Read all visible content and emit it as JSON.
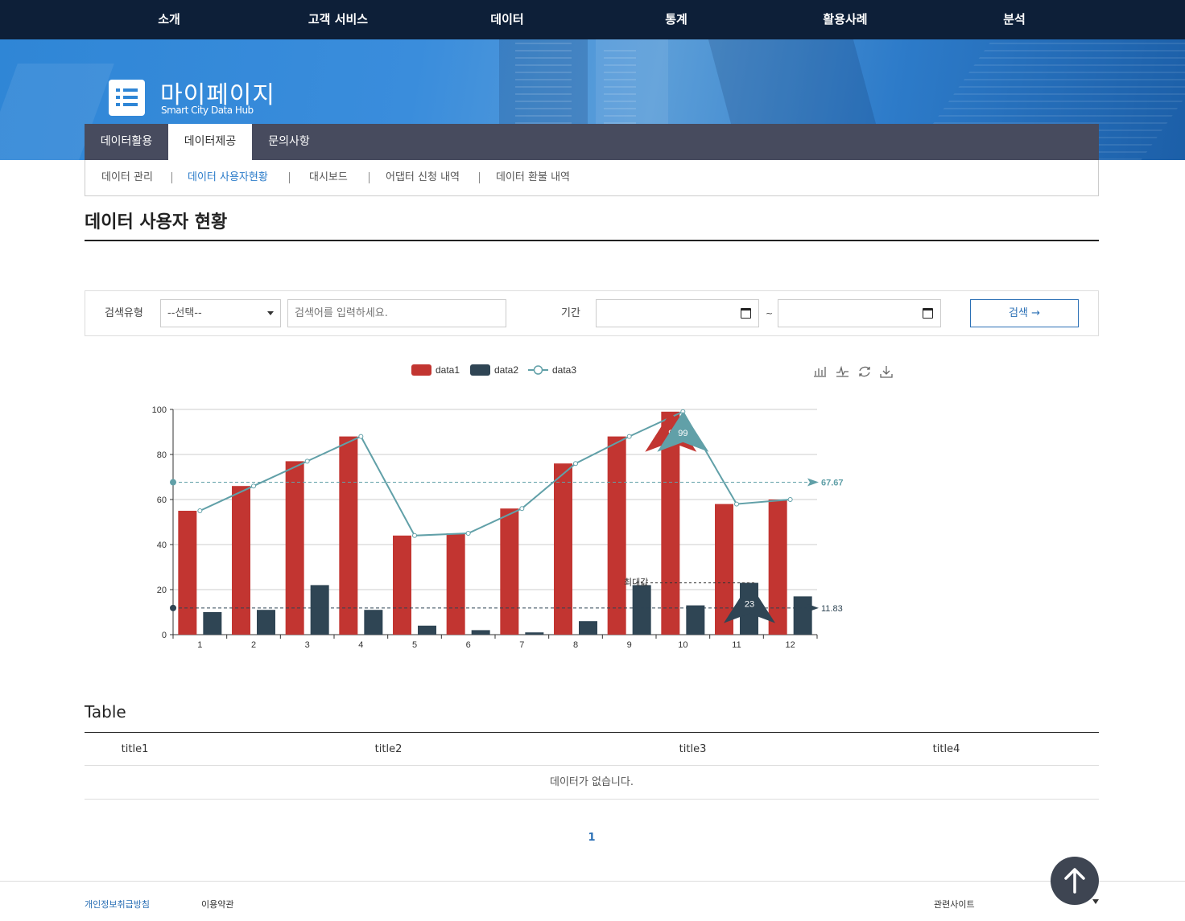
{
  "topnav": [
    "소개",
    "고객 서비스",
    "데이터",
    "통계",
    "활용사례",
    "분석"
  ],
  "banner": {
    "title": "마이페이지",
    "subtitle": "Smart City Data Hub",
    "icon": "list-icon"
  },
  "tabs": [
    {
      "label": "데이터활용",
      "active": false
    },
    {
      "label": "데이터제공",
      "active": true
    },
    {
      "label": "문의사항",
      "active": false
    }
  ],
  "subnav": [
    {
      "label": "데이터 관리",
      "active": false
    },
    {
      "label": "데이터 사용자현황",
      "active": true
    },
    {
      "label": "대시보드",
      "active": false
    },
    {
      "label": "어댑터 신청 내역",
      "active": false
    },
    {
      "label": "데이터 환불 내역",
      "active": false
    }
  ],
  "page_title": "데이터 사용자 현황",
  "search": {
    "type_label": "검색유형",
    "type_value": "--선택--",
    "keyword_placeholder": "검색어를 입력하세요.",
    "period_label": "기간",
    "tilde": "~",
    "button_label": "검색 →"
  },
  "chart_data": {
    "type": "bar",
    "categories": [
      "1",
      "2",
      "3",
      "4",
      "5",
      "6",
      "7",
      "8",
      "9",
      "10",
      "11",
      "12"
    ],
    "series": [
      {
        "name": "data1",
        "type": "bar",
        "color": "#c23531",
        "values": [
          55,
          66,
          77,
          88,
          44,
          45,
          56,
          76,
          88,
          99,
          58,
          60
        ]
      },
      {
        "name": "data2",
        "type": "bar",
        "color": "#2f4554",
        "values": [
          10,
          11,
          22,
          11,
          4,
          2,
          1,
          6,
          22,
          13,
          23,
          17
        ]
      },
      {
        "name": "data3",
        "type": "line",
        "color": "#61a0a8",
        "values": [
          55,
          66,
          77,
          88,
          44,
          45,
          56,
          76,
          88,
          99,
          58,
          60
        ]
      }
    ],
    "ylim": [
      0,
      100
    ],
    "yticks": [
      0,
      20,
      40,
      60,
      80,
      100
    ],
    "grid": true,
    "legend_position": "top",
    "toolbox_icons": [
      "bar-chart-icon",
      "line-chart-icon",
      "refresh-icon",
      "download-icon"
    ],
    "markpoints": [
      {
        "series": "data1",
        "category": "10",
        "value": 99,
        "label": "9"
      },
      {
        "series": "data3",
        "category": "10",
        "value": 99,
        "label": "99"
      },
      {
        "series": "data2",
        "category": "11",
        "value": 23,
        "label": "23"
      }
    ],
    "marklines": [
      {
        "series": "data3",
        "value": 67.67,
        "label": "67.67"
      },
      {
        "series": "data2",
        "value": 11.83,
        "label": "11.83"
      },
      {
        "series": "data2",
        "value": 23,
        "label": "최대값"
      }
    ]
  },
  "table": {
    "title": "Table",
    "headers": [
      "title1",
      "title2",
      "title3",
      "title4"
    ],
    "empty_text": "데이터가 없습니다."
  },
  "pagination": {
    "current": "1"
  },
  "footer": {
    "privacy": "개인정보취급방침",
    "terms": "이용약관",
    "related": "관련사이트"
  }
}
